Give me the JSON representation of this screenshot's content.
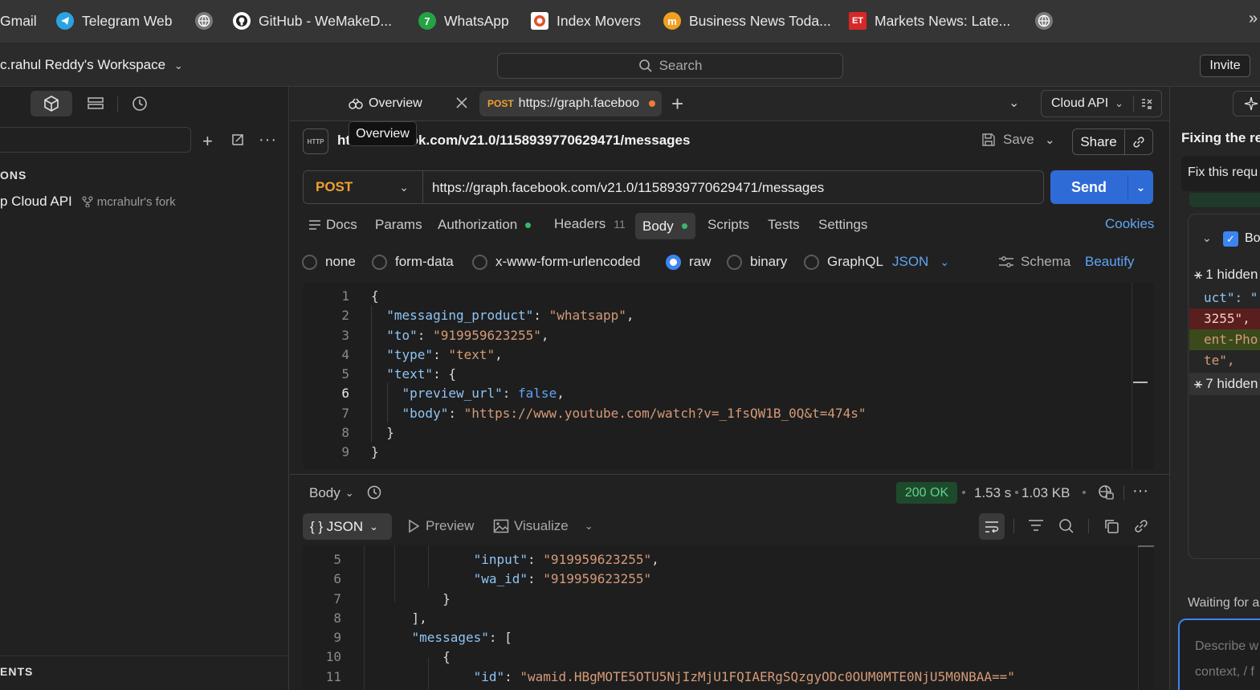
{
  "bookmarks": [
    {
      "label": "Gmail",
      "icon": "gmail-icon",
      "color": "#353535"
    },
    {
      "label": "Telegram Web",
      "icon": "telegram-icon",
      "color": "#2aa3e0"
    },
    {
      "label": "",
      "icon": "globe-icon",
      "color": "#9a9a9a"
    },
    {
      "label": "GitHub - WeMakeD...",
      "icon": "github-icon",
      "color": "#ffffff"
    },
    {
      "label": "WhatsApp",
      "icon": "whatsapp-icon",
      "color": "#25a244"
    },
    {
      "label": "Index Movers",
      "icon": "index-movers-icon",
      "color": "#e0502a"
    },
    {
      "label": "Business News Toda...",
      "icon": "moneycontrol-icon",
      "color": "#f0a020"
    },
    {
      "label": "Markets News: Late...",
      "icon": "et-icon",
      "color": "#d62828"
    },
    {
      "label": "",
      "icon": "globe-icon",
      "color": "#9a9a9a"
    }
  ],
  "header": {
    "workspace": "c.rahul Reddy's Workspace",
    "search_placeholder": "Search",
    "invite": "Invite"
  },
  "sidebar": {
    "section_collections": "ONS",
    "collection_name": "p Cloud API",
    "fork_label": "mcrahulr's fork",
    "section_environments": "ENTS"
  },
  "tabs": {
    "overview": "Overview",
    "request_method": "POST",
    "request_label": "https://graph.faceboo",
    "environment": "Cloud API",
    "tooltip": "Overview"
  },
  "request": {
    "title": "https://graph.facebook.com/v21.0/1158939770629471/messages",
    "title_visible": "ht                 h.facebook.com/v21.0/1158939770629471/messages",
    "save": "Save",
    "share": "Share",
    "method": "POST",
    "url": "https://graph.facebook.com/v21.0/1158939770629471/messages",
    "send": "Send",
    "tabs": {
      "docs": "Docs",
      "params": "Params",
      "authorization": "Authorization",
      "headers": "Headers",
      "headers_count": "11",
      "body": "Body",
      "scripts": "Scripts",
      "tests": "Tests",
      "settings": "Settings",
      "cookies": "Cookies"
    },
    "body_types": {
      "none": "none",
      "form_data": "form-data",
      "urlencoded": "x-www-form-urlencoded",
      "raw": "raw",
      "binary": "binary",
      "graphql": "GraphQL",
      "format": "JSON",
      "schema": "Schema",
      "beautify": "Beautify"
    },
    "body_lines": [
      "{",
      "  \"messaging_product\": \"whatsapp\",",
      "  \"to\": \"919959623255\",",
      "  \"type\": \"text\",",
      "  \"text\": {",
      "    \"preview_url\": false,",
      "    \"body\": \"https://www.youtube.com/watch?v=_1fsQW1B_0Q&t=474s\"",
      "  }",
      "}"
    ],
    "body_line_numbers": [
      "1",
      "2",
      "3",
      "4",
      "5",
      "6",
      "7",
      "8",
      "9"
    ]
  },
  "response": {
    "label": "Body",
    "status": "200 OK",
    "time": "1.53 s",
    "size": "1.03 KB",
    "format": "{ } JSON",
    "preview": "Preview",
    "visualize": "Visualize",
    "line_numbers": [
      "5",
      "6",
      "7",
      "8",
      "9",
      "10",
      "11"
    ],
    "lines": [
      "            \"input\": \"919959623255\",",
      "            \"wa_id\": \"919959623255\"",
      "        }",
      "    ],",
      "    \"messages\": [",
      "        {",
      "            \"id\": \"wamid.HBgMOTE5OTU5NjIzMjU1FQIAERgSQzgyODc0OUM0MTE0NjU5M0NBAA==\""
    ]
  },
  "right_panel": {
    "title": "Fixing the re",
    "prompt": "Fix this requ",
    "item": "Bo",
    "hidden1": "1 hidden",
    "code1": "uct\": \"",
    "code2": "3255\",",
    "code3": "ent-Pho",
    "code4": "te\",",
    "hidden2": "7 hidden",
    "waiting": "Waiting for a",
    "input_line1": "Describe w",
    "input_line2": "context, / f"
  }
}
